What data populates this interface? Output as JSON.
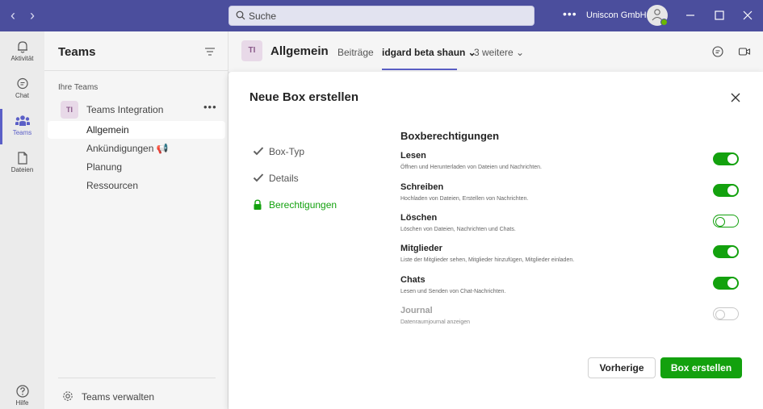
{
  "titlebar": {
    "search_placeholder": "Suche",
    "more_label": "•••",
    "org_name": "Uniscon GmbH"
  },
  "rail": {
    "items": [
      {
        "label": "Aktivität",
        "icon": "bell-icon"
      },
      {
        "label": "Chat",
        "icon": "chat-icon"
      },
      {
        "label": "Teams",
        "icon": "teams-icon",
        "active": true
      },
      {
        "label": "Dateien",
        "icon": "file-icon"
      },
      {
        "label": "Hilfe",
        "icon": "help-icon"
      }
    ]
  },
  "panel": {
    "title": "Teams",
    "section_label": "Ihre Teams",
    "team": {
      "initials": "TI",
      "name": "Teams Integration",
      "more": "•••"
    },
    "channels": [
      {
        "name": "Allgemein",
        "active": true
      },
      {
        "name": "Ankündigungen 📢"
      },
      {
        "name": "Planung"
      },
      {
        "name": "Ressourcen"
      }
    ],
    "manage_label": "Teams verwalten"
  },
  "header": {
    "initials": "TI",
    "title": "Allgemein",
    "tabs": [
      {
        "label": "Beiträge"
      },
      {
        "label": "idgard beta shaun ⌄",
        "active": true
      },
      {
        "label": "3 weitere ⌄"
      }
    ]
  },
  "dialog": {
    "title": "Neue Box erstellen",
    "steps": [
      {
        "label": "Box-Typ",
        "state": "done"
      },
      {
        "label": "Details",
        "state": "done"
      },
      {
        "label": "Berechtigungen",
        "state": "active"
      }
    ],
    "permissions_heading": "Boxberechtigungen",
    "permissions": [
      {
        "title": "Lesen",
        "desc": "Öffnen und Herunterladen von Dateien und Nachrichten.",
        "enabled": true,
        "disabled": false
      },
      {
        "title": "Schreiben",
        "desc": "Hochladen von Dateien, Erstellen von Nachrichten.",
        "enabled": true,
        "disabled": false
      },
      {
        "title": "Löschen",
        "desc": "Löschen von Dateien, Nachrichten und Chats.",
        "enabled": false,
        "disabled": false
      },
      {
        "title": "Mitglieder",
        "desc": "Liste der Mitglieder sehen, Mitglieder hinzufügen, Mitglieder einladen.",
        "enabled": true,
        "disabled": false
      },
      {
        "title": "Chats",
        "desc": "Lesen und Senden von Chat-Nachrichten.",
        "enabled": true,
        "disabled": false
      },
      {
        "title": "Journal",
        "desc": "Datenraumjournal anzeigen",
        "enabled": false,
        "disabled": true
      }
    ],
    "prev_label": "Vorherige",
    "create_label": "Box erstellen"
  },
  "colors": {
    "titlebar": "#4b4e9d",
    "accent": "#5b5fc7",
    "success": "#13a10e"
  }
}
